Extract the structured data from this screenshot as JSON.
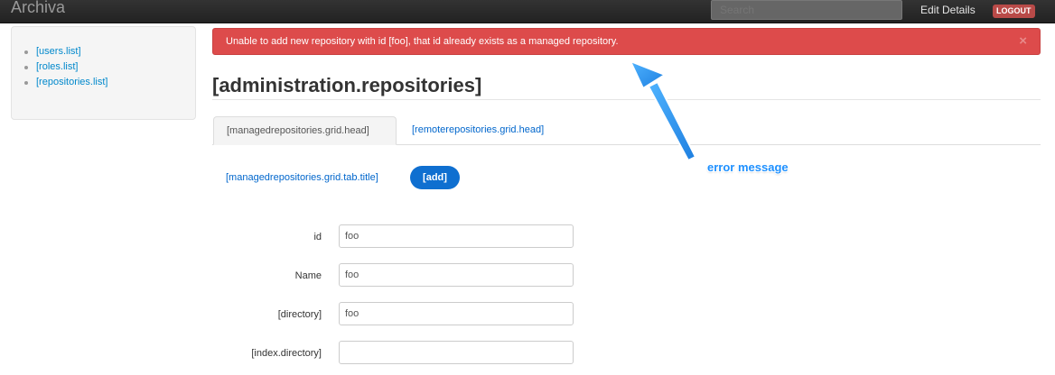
{
  "navbar": {
    "brand": "Archiva",
    "search_placeholder": "Search",
    "edit_details": "Edit Details",
    "logout": "LOGOUT"
  },
  "sidebar": {
    "items": [
      {
        "label": "[users.list]"
      },
      {
        "label": "[roles.list]"
      },
      {
        "label": "[repositories.list]"
      }
    ]
  },
  "alert": {
    "message": "Unable to add new repository with id [foo], that id already exists as a managed repository.",
    "close": "×"
  },
  "page": {
    "title": "[administration.repositories]"
  },
  "tabs": [
    {
      "label": "[managedrepositories.grid.head]",
      "active": true
    },
    {
      "label": "[remoterepositories.grid.head]",
      "active": false
    }
  ],
  "grid": {
    "tab_title": "[managedrepositories.grid.tab.title]",
    "add_label": "[add]"
  },
  "form": {
    "fields": [
      {
        "label": "id",
        "value": "foo"
      },
      {
        "label": "Name",
        "value": "foo"
      },
      {
        "label": "[directory]",
        "value": "foo"
      },
      {
        "label": "[index.directory]",
        "value": ""
      }
    ]
  },
  "annotation": {
    "text": "error message",
    "color": "#1e90ff"
  }
}
